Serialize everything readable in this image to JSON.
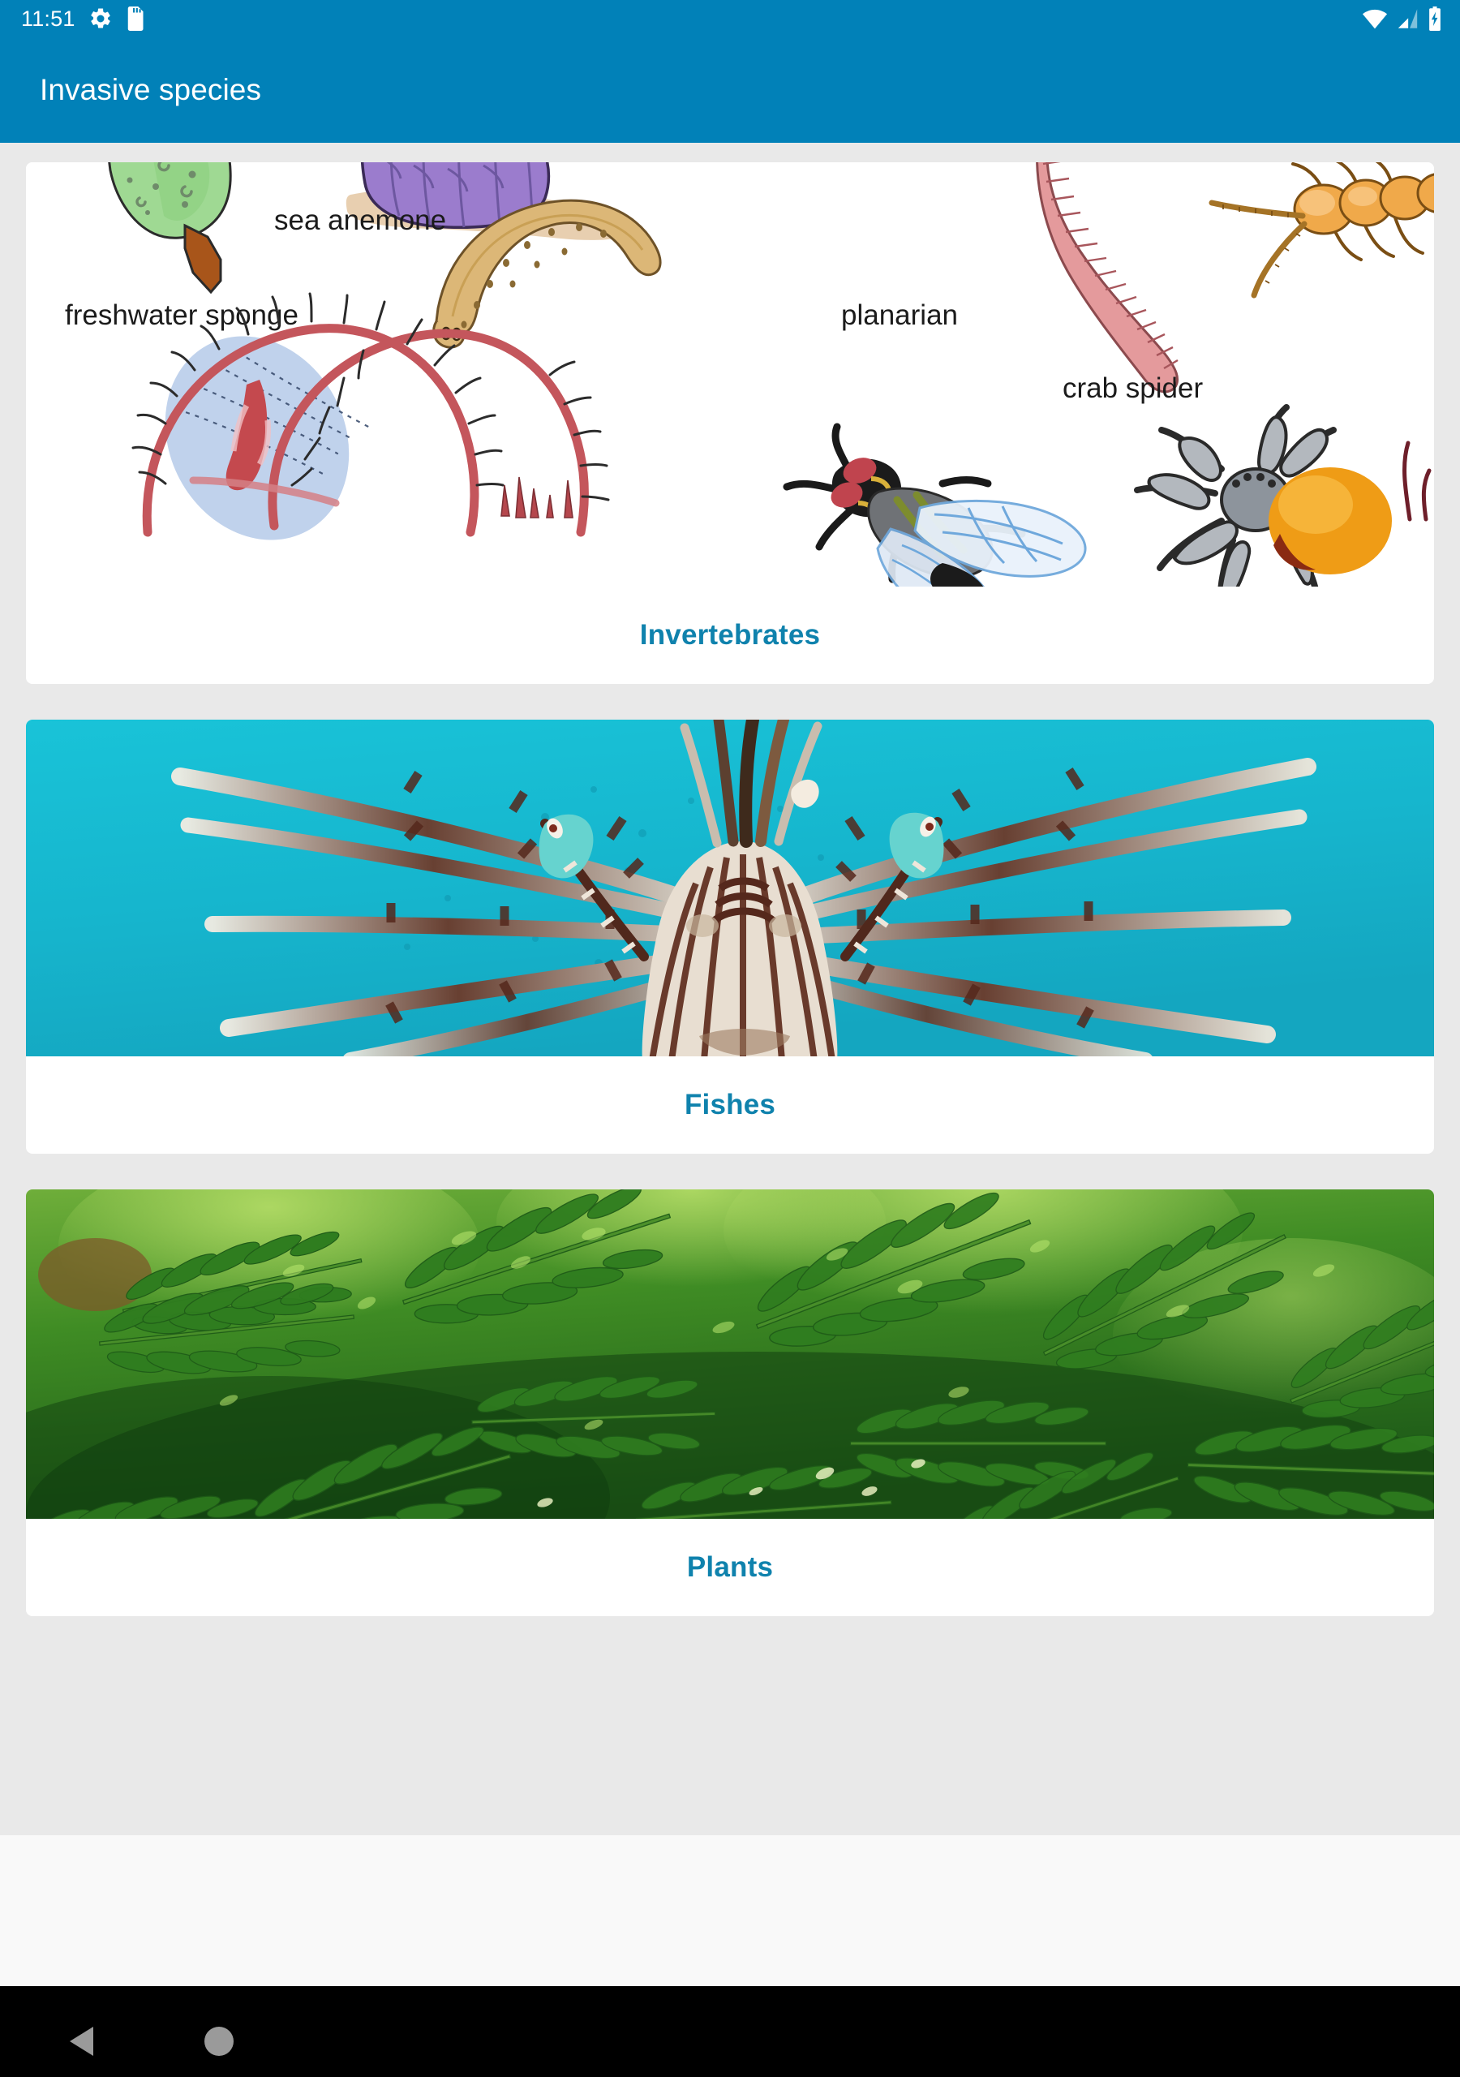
{
  "status_bar": {
    "clock": "11:51",
    "left_icons": [
      "gear-icon",
      "sd-card-icon"
    ],
    "right_icons": [
      "wifi-icon",
      "cellular-signal-icon",
      "battery-charging-icon"
    ],
    "background_color": "#0181b8"
  },
  "app_bar": {
    "title": "Invasive species",
    "background_color": "#0181b8",
    "title_color": "#ffffff"
  },
  "theme": {
    "accent_color": "#0f82ad",
    "page_background": "#e9e9e9",
    "card_background": "#ffffff",
    "footer_background": "#f9f9f9",
    "nav_bar_background": "#000000"
  },
  "cards": [
    {
      "id": "invertebrates",
      "caption": "Invertebrates",
      "media_type": "illustration-collage",
      "media_alt": "Scientific illustration collage of invertebrate animals",
      "labels": [
        "freshwater sponge",
        "sea anemone",
        "planarian",
        "crab spider"
      ],
      "organisms": [
        "freshwater sponge",
        "sea anemone",
        "planarian",
        "earthworm",
        "centipede",
        "hydra",
        "housefly",
        "crab spider"
      ]
    },
    {
      "id": "fishes",
      "caption": "Fishes",
      "media_type": "photograph",
      "media_alt": "Lionfish with striped spines in turquoise water",
      "water_color": "#17b9cf"
    },
    {
      "id": "plants",
      "caption": "Plants",
      "media_type": "photograph",
      "media_alt": "Dense green compound-leaf foliage of tree of heaven",
      "foliage_color": "#2f7d1f"
    }
  ],
  "nav_bar": {
    "buttons": [
      "back-button",
      "home-button"
    ]
  }
}
